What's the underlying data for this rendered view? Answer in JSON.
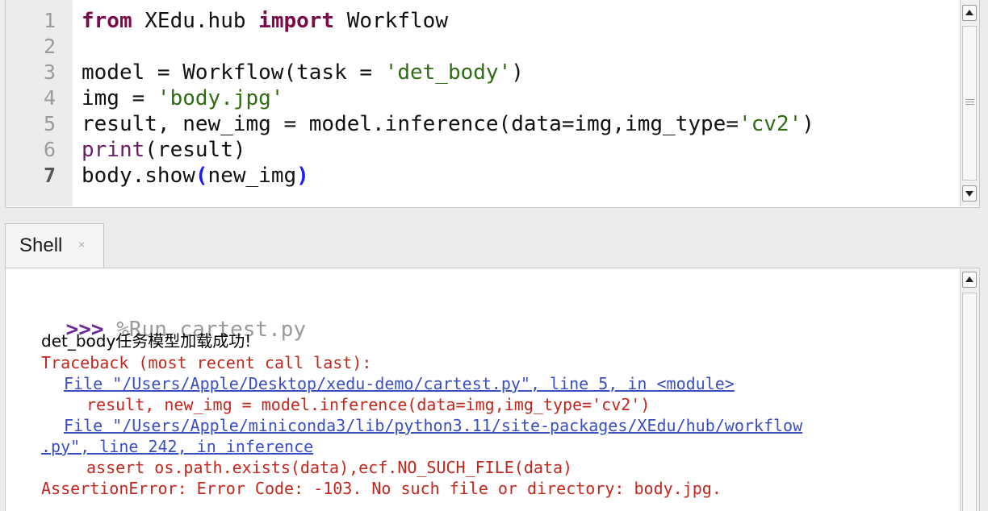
{
  "editor": {
    "line_numbers": [
      "1",
      "2",
      "3",
      "4",
      "5",
      "6",
      "7"
    ],
    "lines": [
      [
        {
          "t": "from",
          "c": "kw"
        },
        {
          "t": " XEdu.hub ",
          "c": ""
        },
        {
          "t": "import",
          "c": "kw"
        },
        {
          "t": " Workflow",
          "c": ""
        }
      ],
      [],
      [
        {
          "t": "model = Workflow(task = ",
          "c": ""
        },
        {
          "t": "'det_body'",
          "c": "str"
        },
        {
          "t": ")",
          "c": ""
        }
      ],
      [
        {
          "t": "img = ",
          "c": ""
        },
        {
          "t": "'body.jpg'",
          "c": "str"
        }
      ],
      [
        {
          "t": "result, new_img = model.inference(data=img,img_type=",
          "c": ""
        },
        {
          "t": "'cv2'",
          "c": "str"
        },
        {
          "t": ")",
          "c": ""
        }
      ],
      [
        {
          "t": "print",
          "c": "bi"
        },
        {
          "t": "(result)",
          "c": ""
        }
      ],
      [
        {
          "t": "body.show",
          "c": ""
        },
        {
          "t": "(",
          "c": "par"
        },
        {
          "t": "new_img",
          "c": ""
        },
        {
          "t": ")",
          "c": "par"
        }
      ]
    ]
  },
  "shell": {
    "tab_label": "Shell",
    "tab_close": "×",
    "prompt": ">>>",
    "command": "%Run cartest.py",
    "output": "det_body任务模型加载成功!",
    "traceback_header": "Traceback (most recent call last):",
    "frame1_link": "File \"/Users/Apple/Desktop/xedu-demo/cartest.py\", line 5, in <module>",
    "frame1_code": "result, new_img = model.inference(data=img,img_type='cv2')",
    "frame2_link_a": "File \"/Users/Apple/miniconda3/lib/python3.11/site-packages/XEdu/hub/workflow",
    "frame2_link_b": ".py\", line 242, in inference",
    "frame2_code": "assert os.path.exists(data),ecf.NO_SUCH_FILE(data)",
    "error": "AssertionError: Error Code: -103. No such file or directory: body.jpg."
  },
  "colors": {
    "keyword": "#7a0a4a",
    "string": "#2e6b12",
    "error": "#c1271d",
    "link": "#3a4fc4",
    "prompt": "#6a2a9a"
  },
  "icons": [
    "scroll-up-arrow-icon",
    "scroll-down-arrow-icon",
    "close-icon"
  ]
}
